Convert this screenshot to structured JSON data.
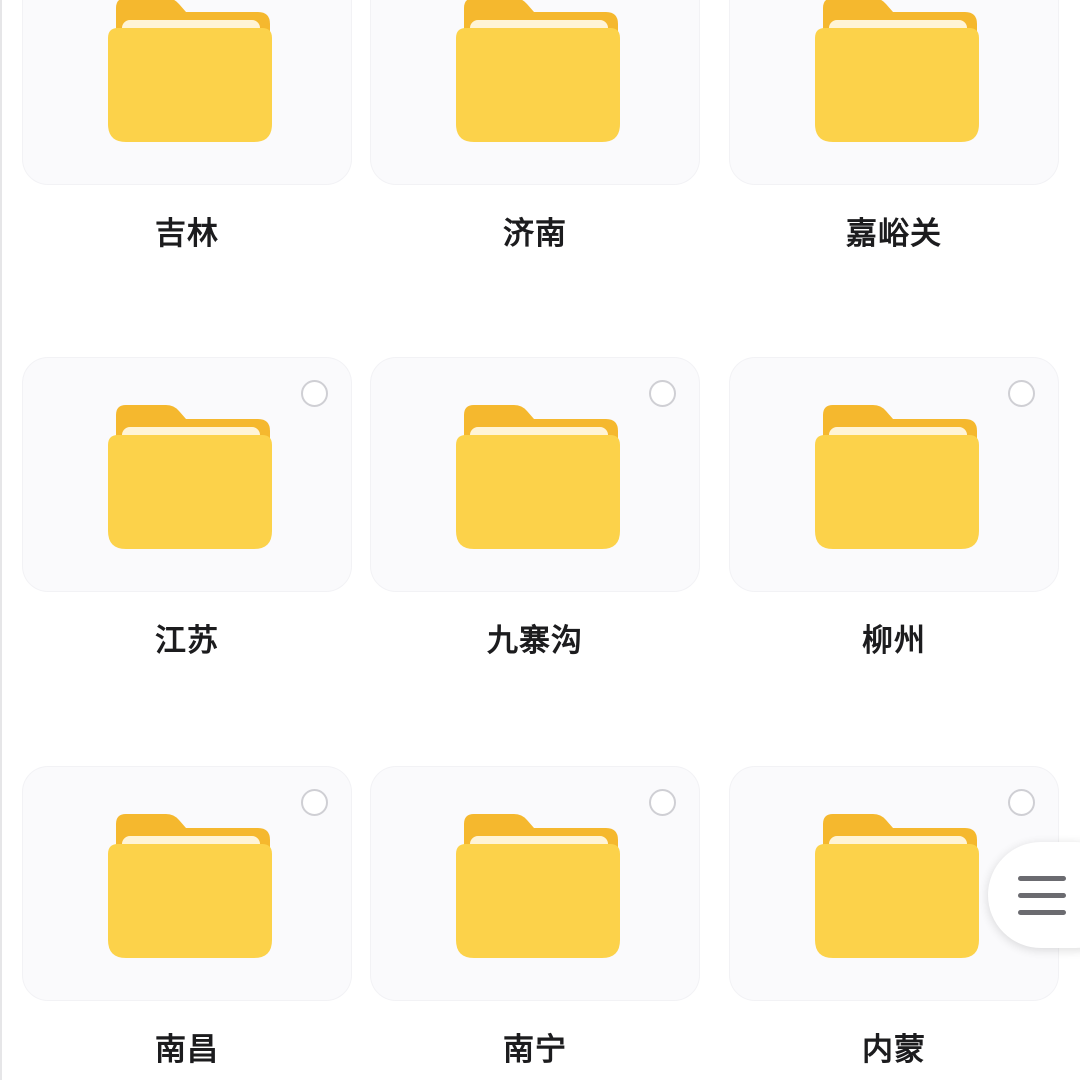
{
  "folders": [
    {
      "label": "吉林",
      "checkbox_visible": false
    },
    {
      "label": "济南",
      "checkbox_visible": false
    },
    {
      "label": "嘉峪关",
      "checkbox_visible": false
    },
    {
      "label": "江苏",
      "checkbox_visible": true
    },
    {
      "label": "九寨沟",
      "checkbox_visible": true
    },
    {
      "label": "柳州",
      "checkbox_visible": true
    },
    {
      "label": "南昌",
      "checkbox_visible": true
    },
    {
      "label": "南宁",
      "checkbox_visible": true
    },
    {
      "label": "内蒙",
      "checkbox_visible": true
    }
  ],
  "icons": {
    "folder": "folder-icon",
    "select": "select-circle-icon",
    "menu": "hamburger-menu-icon"
  },
  "colors": {
    "folder_back": "#F5B82E",
    "folder_paper": "#FFF4D6",
    "folder_front": "#FCD24A",
    "label_text": "#1C1C1E",
    "select_border": "#CFCFD4"
  }
}
